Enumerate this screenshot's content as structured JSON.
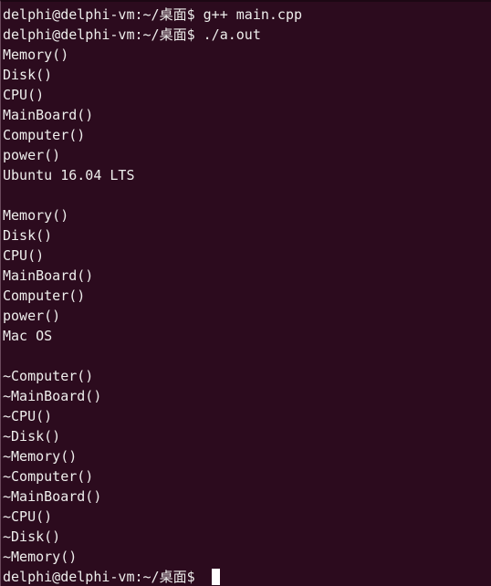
{
  "terminal": {
    "title": "delphi@delphi-vm: ~/桌面",
    "background_color": "#2C0B1E",
    "foreground_color": "#EEEEEC",
    "cursor_color": "#FFFFFF",
    "prompt": "delphi@delphi-vm:~/桌面$ ",
    "lines": [
      {
        "type": "prompt",
        "prompt": "delphi@delphi-vm:~/桌面$ ",
        "command": "g++ main.cpp"
      },
      {
        "type": "prompt",
        "prompt": "delphi@delphi-vm:~/桌面$ ",
        "command": "./a.out"
      },
      {
        "type": "output",
        "text": "Memory()"
      },
      {
        "type": "output",
        "text": "Disk()"
      },
      {
        "type": "output",
        "text": "CPU()"
      },
      {
        "type": "output",
        "text": "MainBoard()"
      },
      {
        "type": "output",
        "text": "Computer()"
      },
      {
        "type": "output",
        "text": "power()"
      },
      {
        "type": "output",
        "text": "Ubuntu 16.04 LTS"
      },
      {
        "type": "blank",
        "text": ""
      },
      {
        "type": "output",
        "text": "Memory()"
      },
      {
        "type": "output",
        "text": "Disk()"
      },
      {
        "type": "output",
        "text": "CPU()"
      },
      {
        "type": "output",
        "text": "MainBoard()"
      },
      {
        "type": "output",
        "text": "Computer()"
      },
      {
        "type": "output",
        "text": "power()"
      },
      {
        "type": "output",
        "text": "Mac OS"
      },
      {
        "type": "blank",
        "text": ""
      },
      {
        "type": "output",
        "text": "~Computer()"
      },
      {
        "type": "output",
        "text": "~MainBoard()"
      },
      {
        "type": "output",
        "text": "~CPU()"
      },
      {
        "type": "output",
        "text": "~Disk()"
      },
      {
        "type": "output",
        "text": "~Memory()"
      },
      {
        "type": "output",
        "text": "~Computer()"
      },
      {
        "type": "output",
        "text": "~MainBoard()"
      },
      {
        "type": "output",
        "text": "~CPU()"
      },
      {
        "type": "output",
        "text": "~Disk()"
      },
      {
        "type": "output",
        "text": "~Memory()"
      },
      {
        "type": "cursor_prompt",
        "prompt": "delphi@delphi-vm:~/桌面$ ",
        "command": ""
      }
    ]
  }
}
